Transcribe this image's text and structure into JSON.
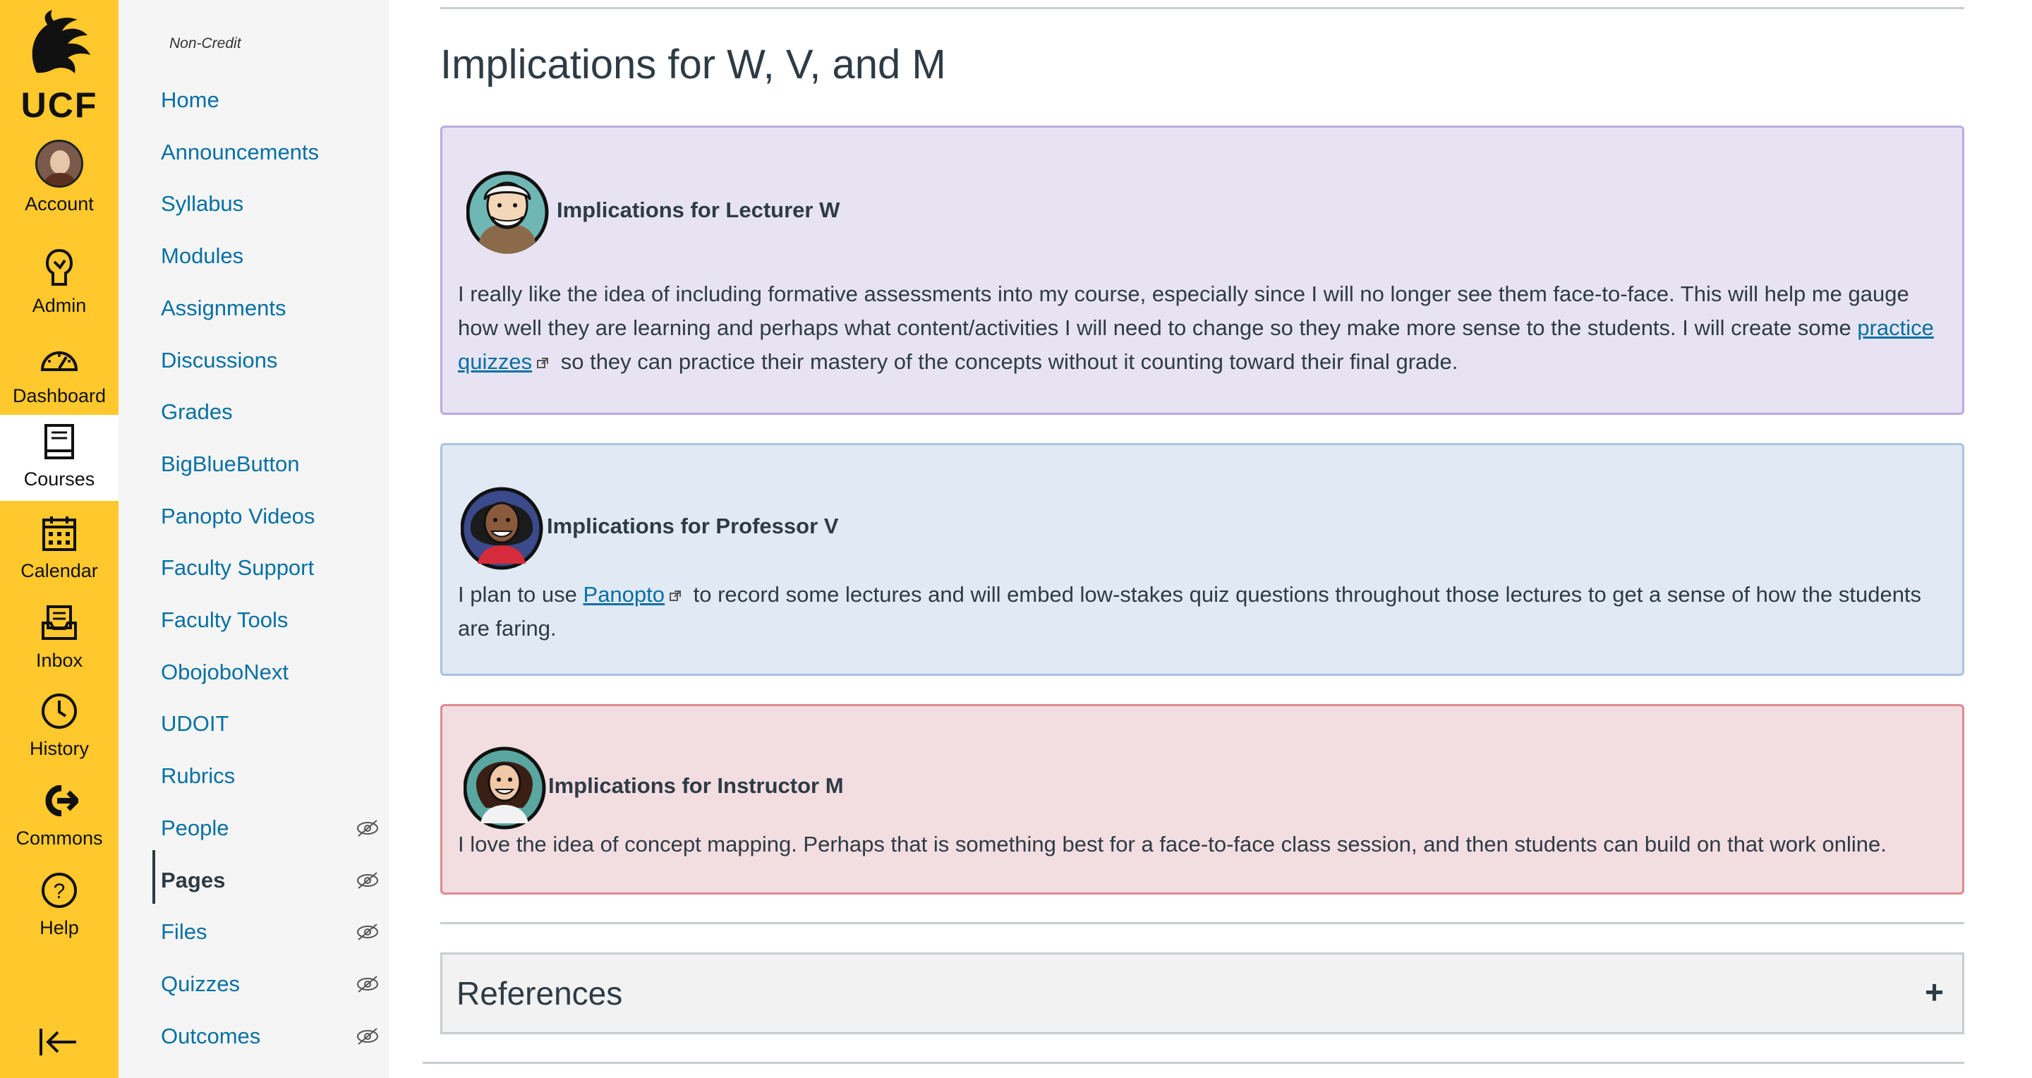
{
  "global_nav": {
    "logo_text": "UCF",
    "items": [
      {
        "label": "Account",
        "icon": "avatar-icon"
      },
      {
        "label": "Admin",
        "icon": "admin-icon"
      },
      {
        "label": "Dashboard",
        "icon": "dashboard-icon"
      },
      {
        "label": "Courses",
        "icon": "courses-icon",
        "active": true
      },
      {
        "label": "Calendar",
        "icon": "calendar-icon"
      },
      {
        "label": "Inbox",
        "icon": "inbox-icon"
      },
      {
        "label": "History",
        "icon": "history-icon"
      },
      {
        "label": "Commons",
        "icon": "commons-icon"
      },
      {
        "label": "Help",
        "icon": "help-icon"
      }
    ],
    "collapse_icon": "collapse-nav-icon",
    "accent_color": "#ffc82c"
  },
  "course_nav": {
    "term": "Non-Credit",
    "items": [
      {
        "label": "Home"
      },
      {
        "label": "Announcements"
      },
      {
        "label": "Syllabus"
      },
      {
        "label": "Modules"
      },
      {
        "label": "Assignments"
      },
      {
        "label": "Discussions"
      },
      {
        "label": "Grades"
      },
      {
        "label": "BigBlueButton"
      },
      {
        "label": "Panopto Videos"
      },
      {
        "label": "Faculty Support"
      },
      {
        "label": "Faculty Tools"
      },
      {
        "label": "ObojoboNext"
      },
      {
        "label": "UDOIT"
      },
      {
        "label": "Rubrics"
      },
      {
        "label": "People",
        "hidden_icon": true
      },
      {
        "label": "Pages",
        "active": true,
        "hidden_icon": true
      },
      {
        "label": "Files",
        "hidden_icon": true
      },
      {
        "label": "Quizzes",
        "hidden_icon": true
      },
      {
        "label": "Outcomes",
        "hidden_icon": true
      }
    ],
    "link_color": "#0770a3"
  },
  "main": {
    "title": "Implications for W, V, and M",
    "cards": [
      {
        "title": "Implications for Lecturer W",
        "text_before": "I really like the idea of including formative assessments into my course, especially since I will no longer see them face-to-face. This will help me gauge how well they are learning and perhaps what content/activities I will need to change so they make more sense to the students. I will create some ",
        "link": "practice quizzes",
        "text_after": " so they can practice their mastery of the concepts without it counting toward their final grade.",
        "bg": "#e8e3f2",
        "border": "#b9abe0"
      },
      {
        "title": "Implications for Professor V",
        "text_before": "I plan to use ",
        "link": "Panopto",
        "text_after": " to record some lectures and will embed low-stakes quiz questions throughout those lectures to get a sense of how the students are faring.",
        "bg": "#e1e9f4",
        "border": "#a9c3e0"
      },
      {
        "title": "Implications for Instructor M",
        "text": "I love the idea of concept mapping. Perhaps that is something best for a face-to-face class session, and then students can build on that work online.",
        "bg": "#f2dde0",
        "border": "#e08a8f"
      }
    ],
    "accordion": {
      "title": "References",
      "toggle": "+"
    }
  }
}
